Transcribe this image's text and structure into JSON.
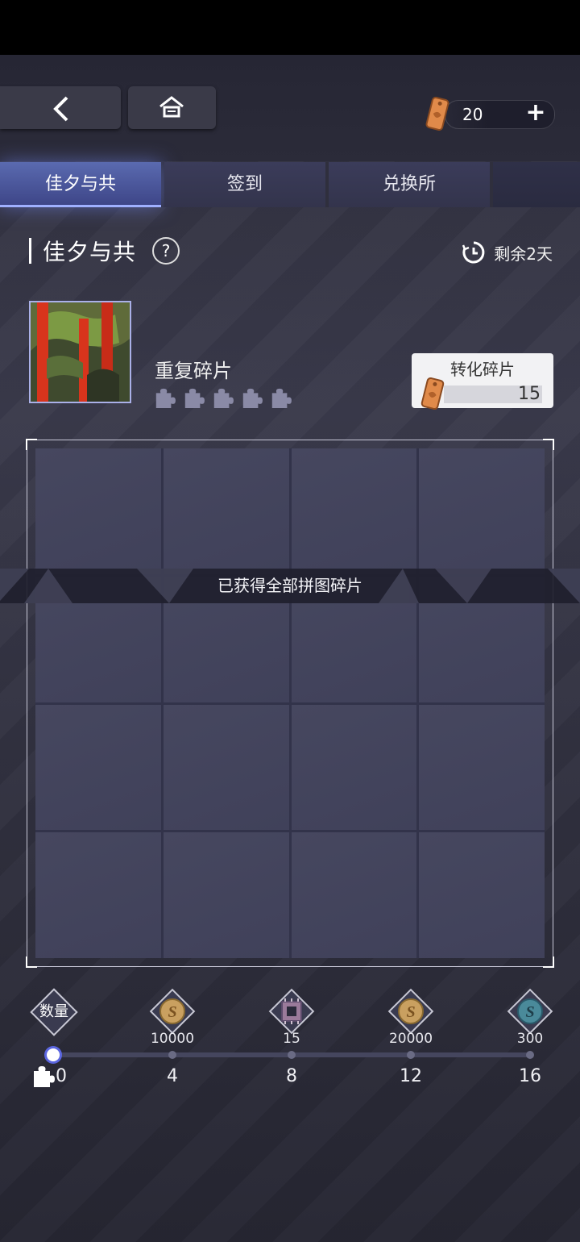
{
  "header": {
    "currency_value": "20",
    "plus_label": "+"
  },
  "tabs": [
    {
      "label": "佳夕与共",
      "active": true
    },
    {
      "label": "签到",
      "active": false
    },
    {
      "label": "兑换所",
      "active": false
    }
  ],
  "section": {
    "title": "佳夕与共",
    "help_label": "?",
    "remaining": "剩余2天"
  },
  "duplicate": {
    "label": "重复碎片",
    "piece_count": 5
  },
  "convert": {
    "label": "转化碎片",
    "count": "15"
  },
  "puzzle": {
    "banner": "已获得全部拼图碎片",
    "cells": 16
  },
  "progress": {
    "label": "数量",
    "current": 0,
    "max": 16,
    "ticks": [
      "0",
      "4",
      "8",
      "12",
      "16"
    ],
    "rewards": [
      {
        "icon": "gold-coin-icon",
        "count": "10000"
      },
      {
        "icon": "chip-icon",
        "count": "15"
      },
      {
        "icon": "gold-coin-icon",
        "count": "20000"
      },
      {
        "icon": "blue-coin-icon",
        "count": "300"
      }
    ]
  },
  "colors": {
    "accent": "#7b87ff",
    "tab_active": "#4a55a0",
    "ticket": "#e08a4a"
  }
}
